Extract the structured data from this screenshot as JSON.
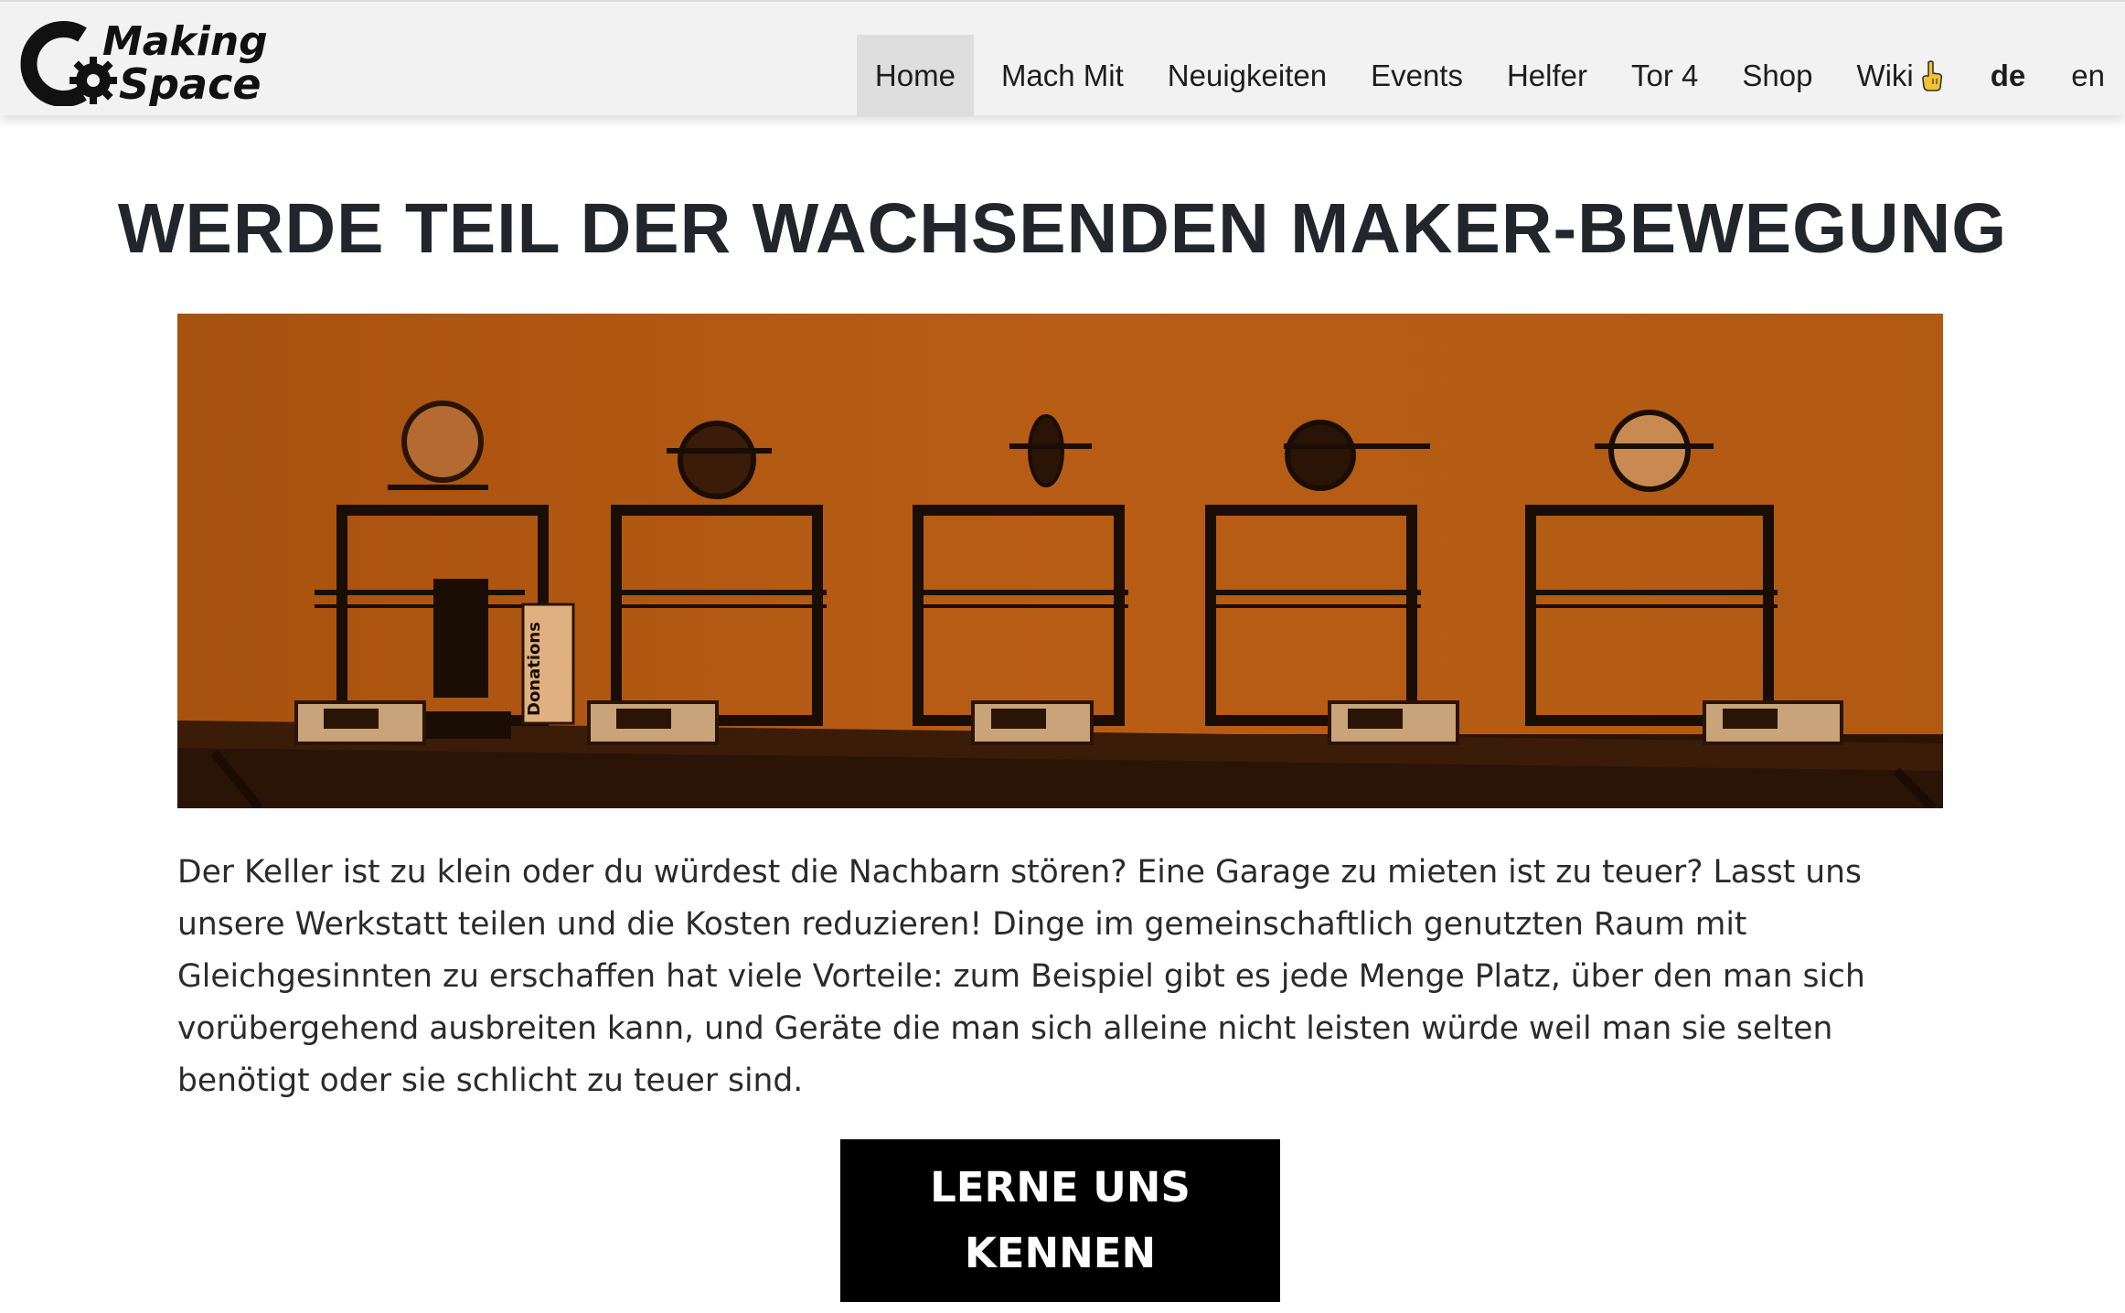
{
  "brand": {
    "line1": "Making",
    "line2": "Space",
    "logo_icon": "gear-c-logo"
  },
  "nav": {
    "items": [
      {
        "label": "Home",
        "active": true
      },
      {
        "label": "Mach Mit"
      },
      {
        "label": "Neuigkeiten"
      },
      {
        "label": "Events"
      },
      {
        "label": "Helfer"
      },
      {
        "label": "Tor 4"
      },
      {
        "label": "Shop"
      },
      {
        "label": "Wiki",
        "icon": "pointing-hand-icon"
      }
    ],
    "languages": [
      {
        "label": "de",
        "active": true
      },
      {
        "label": "en"
      }
    ]
  },
  "main": {
    "headline": "WERDE TEIL DER WACHSENDEN MAKER-BEWEGUNG",
    "hero_image": {
      "subject": "3d-printers-row",
      "tint": "#b35a14",
      "can_label": "Donations"
    },
    "intro": "Der Keller ist zu klein oder du würdest die Nachbarn stören? Eine Garage zu mieten ist zu teuer? Lasst uns unsere Werkstatt teilen und die Kosten reduzieren! Dinge im gemeinschaftlich genutzten Raum mit Gleichgesinnten zu erschaffen hat viele Vorteile: zum Beispiel gibt es jede Menge Platz, über den man sich vorübergehend ausbreiten kann, und Geräte die man sich alleine nicht leisten würde weil man sie selten benötigt oder sie schlicht zu teuer sind.",
    "cta_label": "LERNE UNS KENNEN"
  },
  "colors": {
    "navbar_bg": "#f2f2f2",
    "nav_active_bg": "#dedede",
    "cta_bg": "#000000",
    "hero_tint": "#b35a14"
  }
}
